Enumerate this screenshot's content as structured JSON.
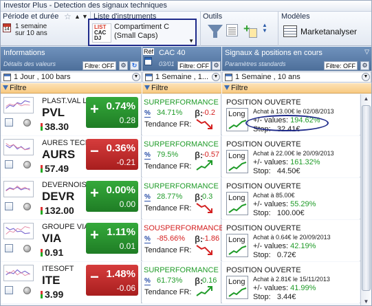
{
  "window": {
    "title": "Investor Plus - Detection des signaux techniques"
  },
  "ribbon": {
    "period": {
      "title": "Période et durée",
      "line1": "1 semaine",
      "line2": "sur 10 ans"
    },
    "instruments": {
      "title": "Liste d'instruments",
      "icon_lines": [
        "LIST",
        "CAC",
        "DJ"
      ],
      "selected": "Compartiment C (Small Caps)"
    },
    "tools": {
      "title": "Outils"
    },
    "models": {
      "title": "Modèles",
      "button_label": "Marketanalyser"
    }
  },
  "columns": {
    "info": {
      "title": "Informations",
      "subtitle": "Détails des valeurs",
      "filter_label": "Filtre: OFF",
      "period": "1 Jour , 100 bars",
      "filter_row": "Filtre"
    },
    "ref": {
      "tag": "Réf",
      "title": "CAC 40",
      "date": "03/01",
      "filter_label": "Filtre: OFF",
      "period": "1 Semaine , 1...",
      "filter_row": "Filtre"
    },
    "signals": {
      "title": "Signaux & positions en cours",
      "subtitle": "Paramètres standards",
      "filter_label": "Filtre: OFF",
      "period": "1 Semaine , 10 ans",
      "filter_row": "Filtre"
    }
  },
  "rows": [
    {
      "name": "PLAST.VAL LOIRE",
      "ticker": "PVL",
      "price": "38.30",
      "direction": "up",
      "var_pct": "0.74%",
      "var_abs": "0.28",
      "perf_label": "SURPERFORMANCE",
      "perf_dir": "up",
      "perf_val": "34.71%",
      "beta": "-0.2",
      "beta_dir": "down",
      "tend_label": "Tendance FR:",
      "trend": "down",
      "sig_title": "POSITION OUVERTE",
      "long_label": "Long",
      "achat": "Achat à 13.00€ le 02/08/2013",
      "values_label": "+/- values:",
      "values": "194.62%",
      "values_dir": "up",
      "stop_label": "Stop:",
      "stop": "32.41€"
    },
    {
      "name": "AURES TECHNOLOGIES",
      "ticker": "AURS",
      "price": "57.49",
      "direction": "down",
      "var_pct": "0.36%",
      "var_abs": "-0.21",
      "perf_label": "SURPERFORMANCE",
      "perf_dir": "up",
      "perf_val": "79.5%",
      "beta": "-0.57",
      "beta_dir": "down",
      "tend_label": "Tendance FR:",
      "trend": "up",
      "sig_title": "POSITION OUVERTE",
      "long_label": "Long",
      "achat": "Achat à 22.00€ le 20/09/2013",
      "values_label": "+/- values:",
      "values": "161.32%",
      "values_dir": "up",
      "stop_label": "Stop:",
      "stop": "44.50€"
    },
    {
      "name": "DEVERNOIS",
      "ticker": "DEVR",
      "price": "132.00",
      "direction": "up",
      "var_pct": "0.00%",
      "var_abs": "0.00",
      "perf_label": "SURPERFORMANCE",
      "perf_dir": "up",
      "perf_val": "28.77%",
      "beta": "0.3",
      "beta_dir": "up",
      "tend_label": "Tendance FR:",
      "trend": "down",
      "sig_title": "POSITION OUVERTE",
      "long_label": "Long",
      "achat": "Achat à 85.00€",
      "values_label": "+/- values:",
      "values": "55.29%",
      "values_dir": "up",
      "stop_label": "Stop:",
      "stop": "100.00€"
    },
    {
      "name": "GROUPE VIAL",
      "ticker": "VIA",
      "price": "0.91",
      "direction": "up",
      "var_pct": "1.11%",
      "var_abs": "0.01",
      "perf_label": "SOUSPERFORMANCE",
      "perf_dir": "down",
      "perf_val": "-85.66%",
      "beta": "-1.86",
      "beta_dir": "down",
      "tend_label": "Tendance FR:",
      "trend": "down",
      "sig_title": "POSITION OUVERTE",
      "long_label": "Long",
      "achat": "Achat à 0.64€ le 20/09/2013",
      "values_label": "+/- values:",
      "values": "42.19%",
      "values_dir": "up",
      "stop_label": "Stop:",
      "stop": "0.72€"
    },
    {
      "name": "ITESOFT",
      "ticker": "ITE",
      "price": "3.99",
      "direction": "down",
      "var_pct": "1.48%",
      "var_abs": "-0.06",
      "perf_label": "SURPERFORMANCE",
      "perf_dir": "up",
      "perf_val": "61.73%",
      "beta": "0.16",
      "beta_dir": "up",
      "tend_label": "Tendance FR:",
      "trend": "up",
      "sig_title": "POSITION OUVERTE",
      "long_label": "Long",
      "achat": "Achat à 2.81€ le 15/11/2013",
      "values_label": "+/- values:",
      "values": "41.99%",
      "values_dir": "up",
      "stop_label": "Stop:",
      "stop": "3.44€"
    }
  ],
  "colors": {
    "up": "#1f9b28",
    "down": "#d42020",
    "header": "#5a7caa",
    "filter_bar": "#f8c981",
    "highlight": "#1e2a8a"
  }
}
